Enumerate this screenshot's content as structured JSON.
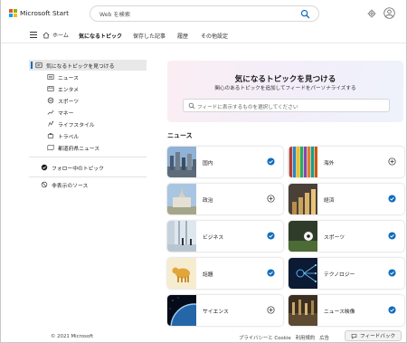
{
  "brand": {
    "name": "Microsoft Start",
    "logo_colors": [
      "#f25022",
      "#7fba00",
      "#00a4ef",
      "#ffb900"
    ]
  },
  "header": {
    "search_placeholder": "Web を検索"
  },
  "nav": {
    "home": "ホーム",
    "items": [
      {
        "label": "気になるトピック",
        "active": true
      },
      {
        "label": "保存した記事",
        "active": false
      },
      {
        "label": "履歴",
        "active": false
      },
      {
        "label": "その他設定",
        "active": false
      }
    ]
  },
  "sidebar": {
    "discover": "気になるトピックを見つける",
    "categories": [
      "ニュース",
      "エンタメ",
      "スポーツ",
      "マネー",
      "ライフスタイル",
      "トラベル",
      "都道府県ニュース"
    ],
    "following": "フォロー中のトピック",
    "hidden": "非表示のソース"
  },
  "hero": {
    "title": "気になるトピックを見つける",
    "subtitle": "関心のあるトピックを追加してフィードをパーソナライズする",
    "search_placeholder": "フィードに表示するものを選択してください"
  },
  "section": {
    "title": "ニュース"
  },
  "topics": [
    {
      "label": "国内",
      "followed": true
    },
    {
      "label": "海外",
      "followed": false
    },
    {
      "label": "政治",
      "followed": false
    },
    {
      "label": "経済",
      "followed": true
    },
    {
      "label": "ビジネス",
      "followed": true
    },
    {
      "label": "スポーツ",
      "followed": true
    },
    {
      "label": "話題",
      "followed": true
    },
    {
      "label": "テクノロジー",
      "followed": true
    },
    {
      "label": "サイエンス",
      "followed": false
    },
    {
      "label": "ニュース映像",
      "followed": true
    }
  ],
  "footer": {
    "copyright": "© 2021 Microsoft",
    "links": [
      "プライバシーと Cookie",
      "利用規約",
      "広告"
    ],
    "feedback": "フィードバック"
  },
  "colors": {
    "accent": "#0f6cbd"
  }
}
